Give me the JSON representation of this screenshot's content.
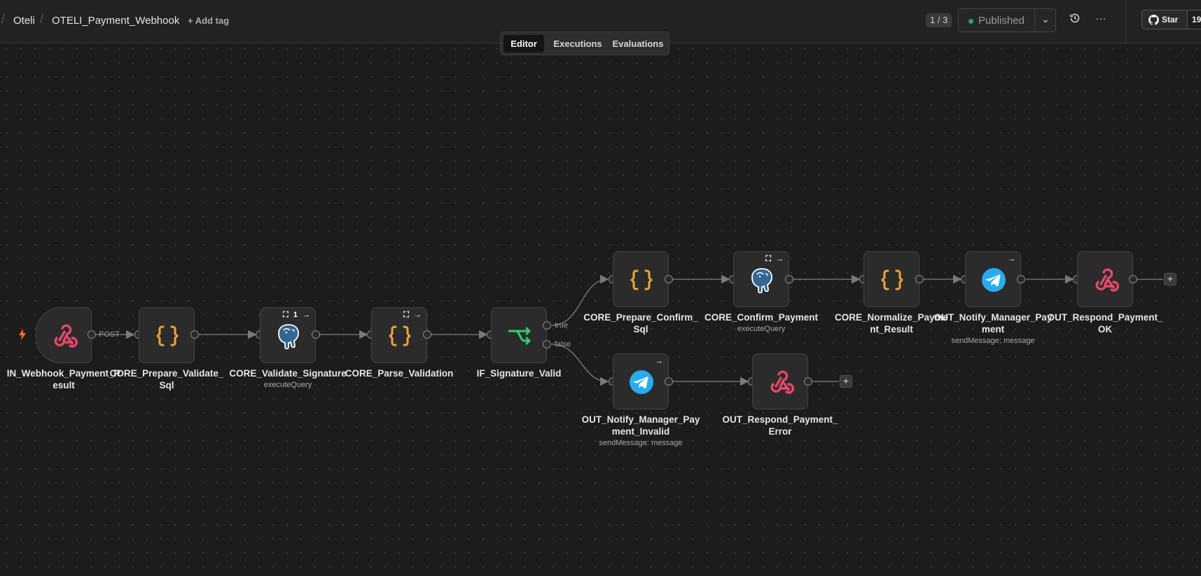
{
  "header": {
    "project": "Oteli",
    "workflow_name": "OTELI_Payment_Webhook",
    "add_tag": "+ Add tag",
    "version": "1 / 3",
    "status": "Published",
    "star_label": "Star",
    "star_count": "19"
  },
  "tabs": [
    {
      "label": "Editor",
      "active": true
    },
    {
      "label": "Executions",
      "active": false
    },
    {
      "label": "Evaluations",
      "active": false
    }
  ],
  "nodes": {
    "in_webhook": {
      "label": "IN_Webhook_Payment_Result",
      "icon": "webhook-icon"
    },
    "prepare_validate": {
      "label": "CORE_Prepare_Validate_Sql",
      "icon": "code-braces-icon"
    },
    "validate_signature": {
      "label": "CORE_Validate_Signature",
      "subtitle": "executeQuery",
      "icon": "postgres-icon",
      "badge_count": "1"
    },
    "parse_validation": {
      "label": "CORE_Parse_Validation",
      "icon": "code-braces-icon"
    },
    "if_signature": {
      "label": "IF_Signature_Valid",
      "icon": "if-branch-icon"
    },
    "prepare_confirm": {
      "label": "CORE_Prepare_Confirm_Sql",
      "icon": "code-braces-icon"
    },
    "confirm_payment": {
      "label": "CORE_Confirm_Payment",
      "subtitle": "executeQuery",
      "icon": "postgres-icon"
    },
    "normalize_result": {
      "label": "CORE_Normalize_Payment_Result",
      "icon": "code-braces-icon"
    },
    "notify_manager_payment": {
      "label": "OUT_Notify_Manager_Payment",
      "subtitle": "sendMessage: message",
      "icon": "telegram-icon"
    },
    "respond_ok": {
      "label": "OUT_Respond_Payment_OK",
      "icon": "webhook-icon"
    },
    "notify_manager_invalid": {
      "label": "OUT_Notify_Manager_Payment_Invalid",
      "subtitle": "sendMessage: message",
      "icon": "telegram-icon"
    },
    "respond_error": {
      "label": "OUT_Respond_Payment_Error",
      "icon": "webhook-icon"
    }
  },
  "edge_labels": {
    "post": "POST",
    "true": "true",
    "false": "false"
  },
  "colors": {
    "canvas": "#1c1c1c",
    "node_bg": "#2b2b2b",
    "webhook": "#e5486b",
    "code": "#f0a43a",
    "if": "#2ecc71",
    "telegram": "#2aabee",
    "postgres": "#336791",
    "published_dot": "#2f9e72"
  }
}
